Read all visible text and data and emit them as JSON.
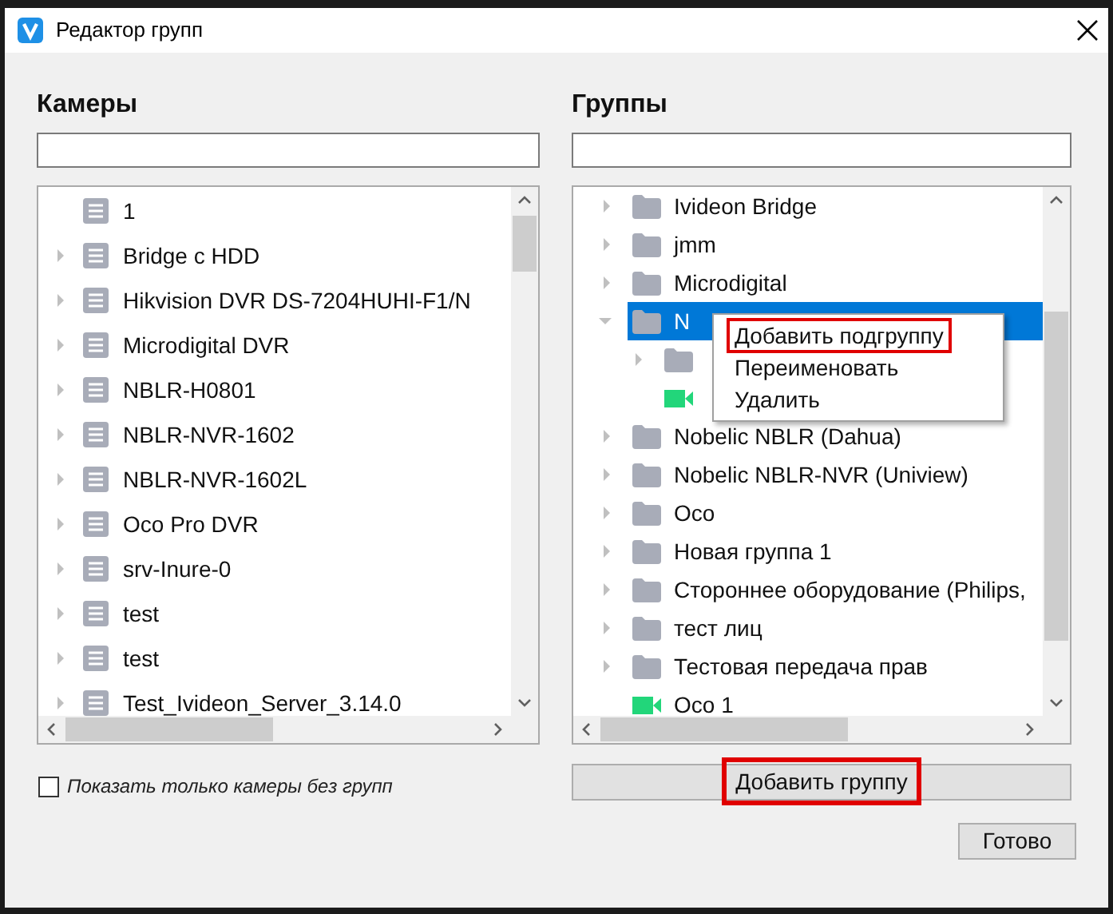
{
  "window": {
    "title": "Редактор групп"
  },
  "cameras": {
    "heading": "Камеры",
    "items": [
      {
        "label": "1",
        "expandable": false
      },
      {
        "label": "Bridge c HDD",
        "expandable": true
      },
      {
        "label": "Hikvision DVR DS-7204HUHI-F1/N",
        "expandable": true
      },
      {
        "label": "Microdigital DVR",
        "expandable": true
      },
      {
        "label": "NBLR-H0801",
        "expandable": true
      },
      {
        "label": "NBLR-NVR-1602",
        "expandable": true
      },
      {
        "label": "NBLR-NVR-1602L",
        "expandable": true
      },
      {
        "label": "Oco Pro DVR",
        "expandable": true
      },
      {
        "label": "srv-Inure-0",
        "expandable": true
      },
      {
        "label": "test",
        "expandable": true
      },
      {
        "label": "test",
        "expandable": true
      },
      {
        "label": "Test_Ivideon_Server_3.14.0",
        "expandable": true
      }
    ]
  },
  "groups": {
    "heading": "Группы",
    "items": [
      {
        "kind": "folder",
        "label": "Ivideon Bridge",
        "expanded": false,
        "selected": false
      },
      {
        "kind": "folder",
        "label": "jmm",
        "expanded": false,
        "selected": false
      },
      {
        "kind": "folder",
        "label": "Microdigital",
        "expanded": false,
        "selected": false
      },
      {
        "kind": "folder",
        "label": "N",
        "expanded": true,
        "selected": true,
        "children": [
          {
            "kind": "folder",
            "expanded": false,
            "selected": false
          },
          {
            "kind": "camera",
            "selected": false
          }
        ]
      },
      {
        "kind": "folder",
        "label": "Nobelic NBLR (Dahua)",
        "expanded": false,
        "selected": false
      },
      {
        "kind": "folder",
        "label": "Nobelic NBLR-NVR (Uniview)",
        "expanded": false,
        "selected": false
      },
      {
        "kind": "folder",
        "label": "Oco",
        "expanded": false,
        "selected": false
      },
      {
        "kind": "folder",
        "label": "Новая группа 1",
        "expanded": false,
        "selected": false
      },
      {
        "kind": "folder",
        "label": "Стороннее оборудование (Philips,",
        "expanded": false,
        "selected": false
      },
      {
        "kind": "folder",
        "label": "тест лиц",
        "expanded": false,
        "selected": false
      },
      {
        "kind": "folder",
        "label": "Тестовая передача прав",
        "expanded": false,
        "selected": false
      },
      {
        "kind": "camera",
        "label": "Oco 1",
        "selected": false
      }
    ]
  },
  "context_menu": {
    "items": [
      {
        "label": "Добавить подгруппу",
        "highlighted": true
      },
      {
        "label": "Переименовать",
        "highlighted": false
      },
      {
        "label": "Удалить",
        "highlighted": false
      }
    ]
  },
  "filter_checkbox": {
    "label": "Показать только камеры без групп",
    "checked": false
  },
  "add_group_button": {
    "label": "Добавить группу",
    "highlighted": true
  },
  "done_button": {
    "label": "Готово"
  }
}
